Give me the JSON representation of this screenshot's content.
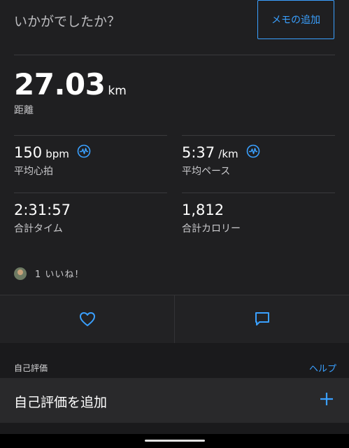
{
  "header": {
    "question": "いかがでしたか？",
    "memo_button": "メモの追加"
  },
  "distance": {
    "value": "27.03",
    "unit": "km",
    "label": "距離"
  },
  "stats": {
    "heart_rate": {
      "value": "150",
      "unit": "bpm",
      "label": "平均心拍",
      "icon": "pulse-icon"
    },
    "pace": {
      "value": "5:37",
      "unit": "/km",
      "label": "平均ペース",
      "icon": "pulse-icon"
    },
    "time": {
      "value": "2:31:57",
      "label": "合計タイム"
    },
    "calories": {
      "value": "1,812",
      "label": "合計カロリー"
    }
  },
  "likes": {
    "text": "1 いいね！"
  },
  "actions": {
    "like_icon": "heart-icon",
    "comment_icon": "comment-icon"
  },
  "self_eval": {
    "title": "自己評価",
    "help": "ヘルプ",
    "add_label": "自己評価を追加",
    "add_icon": "plus-icon"
  },
  "colors": {
    "accent": "#3aa0ff",
    "background": "#1f1f21"
  }
}
